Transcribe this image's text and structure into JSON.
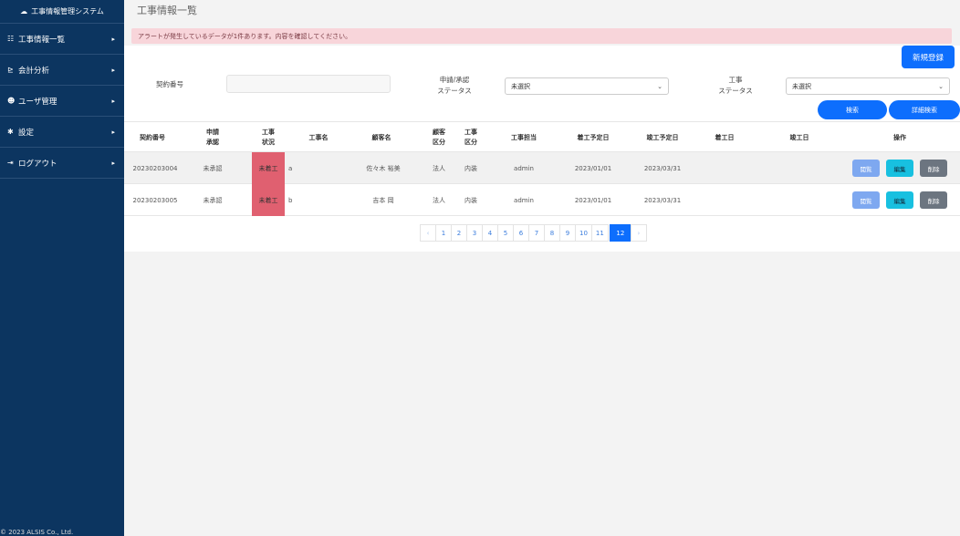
{
  "app": {
    "brand": "工事情報管理システム",
    "copyright": "© 2023 ALSIS Co., Ltd."
  },
  "sidebar": {
    "items": [
      {
        "icon": "list-icon",
        "label": "工事情報一覧"
      },
      {
        "icon": "chart-icon",
        "label": "会計分析"
      },
      {
        "icon": "users-icon",
        "label": "ユーザ管理"
      },
      {
        "icon": "gear-icon",
        "label": "設定"
      },
      {
        "icon": "logout-icon",
        "label": "ログアウト"
      }
    ]
  },
  "page": {
    "title": "工事情報一覧",
    "alert": "アラートが発生しているデータが1件あります。内容を確認してください。",
    "new_button": "新規登録"
  },
  "filters": {
    "contract_label": "契約番号",
    "contract_value": "",
    "approval_label_1": "申請/承認",
    "approval_label_2": "ステータス",
    "approval_value": "未選択",
    "work_label_1": "工事",
    "work_label_2": "ステータス",
    "work_value": "未選択",
    "search_button": "検索",
    "advanced_button": "詳細検索"
  },
  "table": {
    "headers": {
      "contract_no": "契約番号",
      "approval_1": "申請",
      "approval_2": "承認",
      "work_status_1": "工事",
      "work_status_2": "状況",
      "work_name": "工事名",
      "customer": "顧客名",
      "customer_type_1": "顧客",
      "customer_type_2": "区分",
      "work_type_1": "工事",
      "work_type_2": "区分",
      "manager": "工事担当",
      "start_plan": "着工予定日",
      "end_plan": "竣工予定日",
      "start": "着工日",
      "end": "竣工日",
      "ops": "操作"
    },
    "rows": [
      {
        "contract_no": "20230203004",
        "approval": "未承認",
        "work_status": "未着工",
        "work_name": "a",
        "customer": "佐々木 裕美",
        "customer_type": "法人",
        "work_type": "内装",
        "manager": "admin",
        "start_plan": "2023/01/01",
        "end_plan": "2023/03/31",
        "start": "",
        "end": ""
      },
      {
        "contract_no": "20230203005",
        "approval": "未承認",
        "work_status": "未着工",
        "work_name": "b",
        "customer": "吉本 岡",
        "customer_type": "法人",
        "work_type": "内装",
        "manager": "admin",
        "start_plan": "2023/01/01",
        "end_plan": "2023/03/31",
        "start": "",
        "end": ""
      }
    ],
    "row_buttons": {
      "view": "閲覧",
      "edit": "編集",
      "delete": "削除"
    }
  },
  "pagination": {
    "prev": "‹",
    "pages": [
      "1",
      "2",
      "3",
      "4",
      "5",
      "6",
      "7",
      "8",
      "9",
      "10",
      "11",
      "12"
    ],
    "current": "12",
    "next": "›"
  },
  "colors": {
    "sidebar": "#0c3560",
    "primary": "#0d6efd",
    "alert_bg": "#f8d5da",
    "status_bg": "#e06070"
  }
}
